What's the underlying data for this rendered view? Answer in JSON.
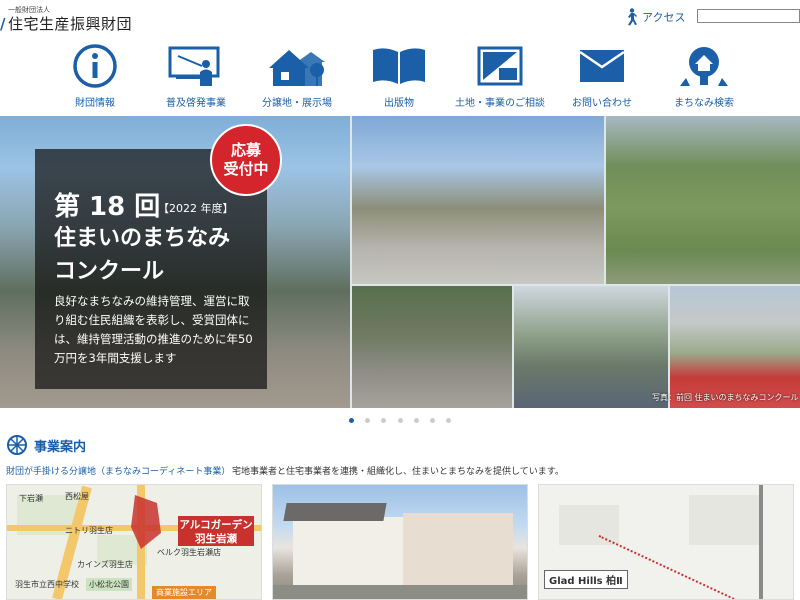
{
  "header": {
    "org_small": "一般財団法人",
    "org_name": "住宅生産振興財団",
    "access_label": "アクセス",
    "search_placeholder": ""
  },
  "nav": [
    {
      "label": "財団情報",
      "icon": "info-icon"
    },
    {
      "label": "普及啓発事業",
      "icon": "presentation-icon"
    },
    {
      "label": "分譲地・展示場",
      "icon": "house-icon"
    },
    {
      "label": "出版物",
      "icon": "book-icon"
    },
    {
      "label": "土地・事業のご相談",
      "icon": "consult-icon"
    },
    {
      "label": "お問い合わせ",
      "icon": "envelope-icon"
    },
    {
      "label": "まちなみ検索",
      "icon": "magnifier-house-icon"
    }
  ],
  "hero": {
    "badge_line1": "応募",
    "badge_line2": "受付中",
    "title_main": "第 18 回",
    "title_year": "【2022 年度】",
    "title_line2": "住まいのまちなみ",
    "title_line3": "コンクール",
    "description": "良好なまちなみの維持管理、運営に取り組む住民組織を表彰し、受賞団体には、維持管理活動の推進のために年50万円を3年間支援します",
    "photo_caption": "写真：前回 住まいのまちなみコンクール",
    "slides": 7,
    "active_slide": 1
  },
  "section": {
    "title": "事業案内",
    "subtitle": "財団が手掛ける分譲地（まちなみコーディネート事業）",
    "description": "宅地事業者と住宅事業者を連携・組織化し、住まいとまちなみを提供しています。"
  },
  "cards": {
    "card1_label_line1": "アルコガーデン",
    "card1_label_line2": "羽生岩瀬",
    "card1_area": "商業施設エリア",
    "card1_school": "小松北公園",
    "card1_places": [
      "下岩瀬",
      "西松屋",
      "ニトリ羽生店",
      "ベルク羽生岩瀬店",
      "カインズ羽生店",
      "小松北公園",
      "羽生市立西中学校"
    ],
    "card3_label": "Glad Hills 柏Ⅱ"
  },
  "colors": {
    "brand_blue": "#1a5fa8",
    "badge_red": "#d3252b",
    "label_red": "#c8312e"
  }
}
